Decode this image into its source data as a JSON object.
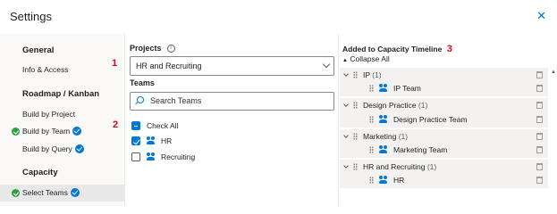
{
  "dialog": {
    "title": "Settings"
  },
  "nav": {
    "general": "General",
    "info_access": "Info & Access",
    "roadmap": "Roadmap / Kanban",
    "build_project": "Build by Project",
    "build_team": "Build by Team",
    "build_query": "Build by Query",
    "capacity": "Capacity",
    "select_teams": "Select Teams"
  },
  "markers": {
    "one": "1",
    "two": "2",
    "three": "3"
  },
  "projects": {
    "label": "Projects",
    "info_icon": "info-icon",
    "selected": "HR and Recruiting"
  },
  "teams": {
    "label": "Teams",
    "search_placeholder": "Search Teams",
    "check_all": "Check All",
    "items": [
      {
        "name": "HR",
        "checked": true
      },
      {
        "name": "Recruiting",
        "checked": false
      }
    ]
  },
  "timeline": {
    "title": "Added to Capacity Timeline",
    "collapse_all": "Collapse All",
    "groups": [
      {
        "name": "IP",
        "count": "(1)",
        "child": "IP Team"
      },
      {
        "name": "Design Practice",
        "count": "(1)",
        "child": "Design Practice Team"
      },
      {
        "name": "Marketing",
        "count": "(1)",
        "child": "Marketing Team"
      },
      {
        "name": "HR and Recruiting",
        "count": "(1)",
        "child": "HR"
      }
    ]
  },
  "colors": {
    "accent": "#0078d4",
    "marker": "#c50f1f",
    "success": "#2ea043"
  }
}
